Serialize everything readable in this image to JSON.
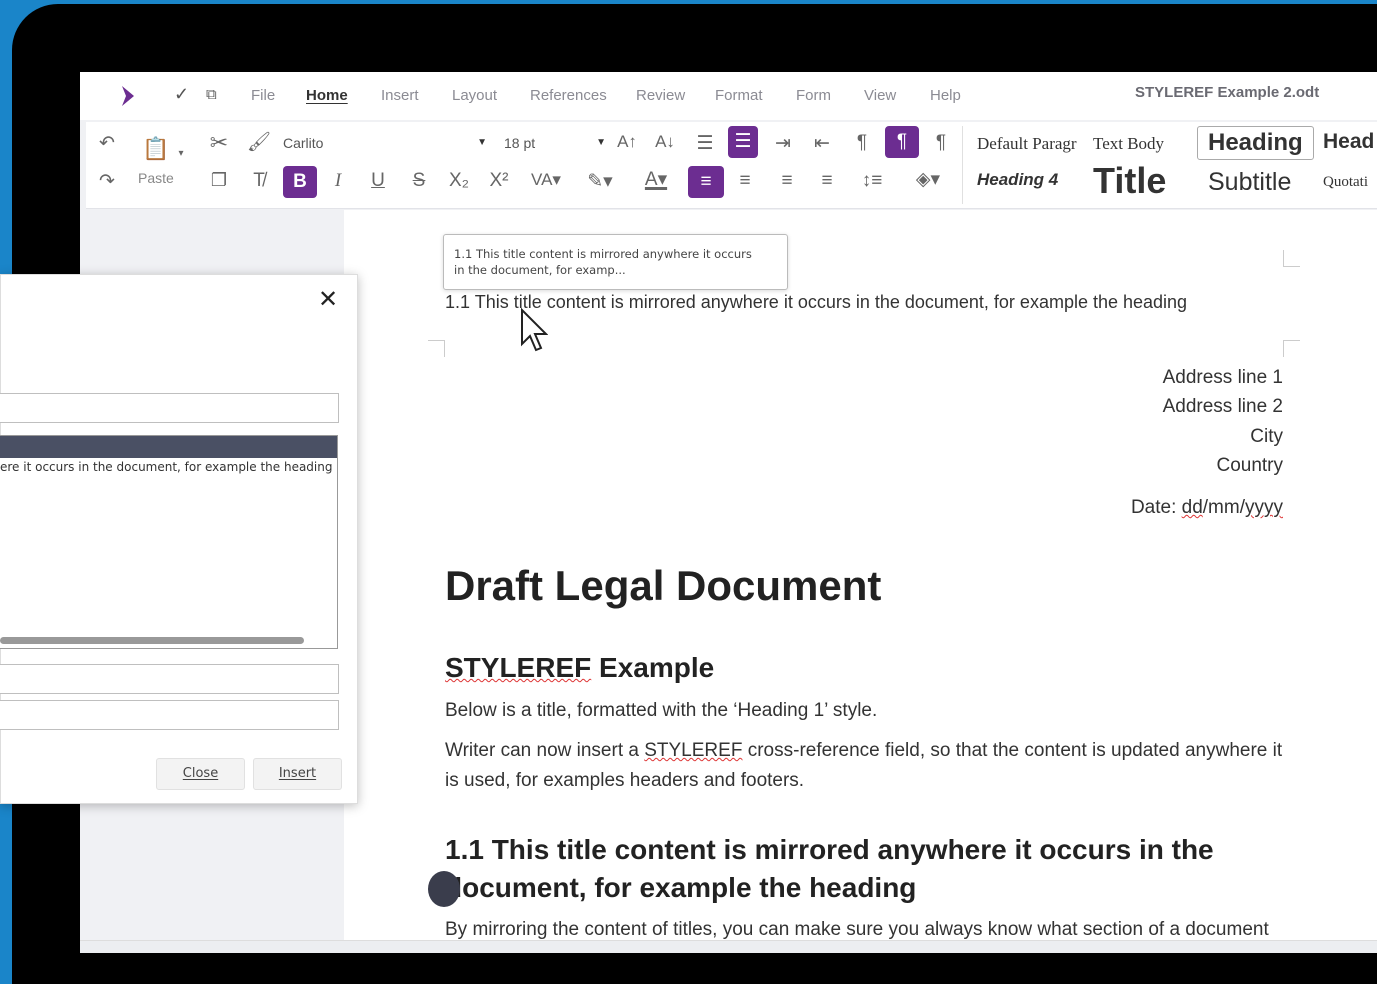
{
  "menubar": {
    "items": [
      "File",
      "Home",
      "Insert",
      "Layout",
      "References",
      "Review",
      "Format",
      "Form",
      "View",
      "Help"
    ],
    "active": "Home",
    "doc_title": "STYLEREF Example 2.odt"
  },
  "toolbar": {
    "paste_label": "Paste",
    "font_name": "Carlito",
    "font_size": "18 pt"
  },
  "styles": {
    "default_paragraph": "Default Paragr",
    "text_body": "Text Body",
    "heading": "Heading",
    "heading_cut": "Head",
    "heading4": "Heading 4",
    "title": "Title",
    "subtitle": "Subtitle",
    "quotations": "Quotati"
  },
  "document": {
    "tooltip_line1": "1.1 This title content is mirrored anywhere it occurs",
    "tooltip_line2": "in the document, for examp...",
    "header_text": "1.1 This title content is mirrored anywhere it occurs in the document, for example the heading",
    "address": [
      "Address line 1",
      "Address line 2",
      "City",
      "Country"
    ],
    "date_label": "Date: ",
    "date_dd": "dd",
    "date_sep": "/mm/",
    "date_yyyy": "yyyy",
    "h_draft": "Draft Legal Document",
    "h_styleref_word": "STYLEREF",
    "h_styleref_rest": " Example",
    "para1": "Below is a title, formatted with the ‘Heading 1’ style.",
    "para2_a": "Writer can now insert a ",
    "para2_word": "STYLEREF",
    "para2_b": " cross-reference field, so that the content is updated anywhere it is used, for examples headers and footers.",
    "h11": "1.1 This title content is mirrored anywhere it occurs in the document, for example the heading",
    "para3": "By mirroring the content of titles, you can make sure you always know what section of a document"
  },
  "dialog": {
    "list_item": "ere it occurs in the document, for example the heading",
    "close_label": "Close",
    "insert_label": "Insert"
  },
  "colors": {
    "accent": "#6c2d91",
    "background": "#1a85c9"
  }
}
